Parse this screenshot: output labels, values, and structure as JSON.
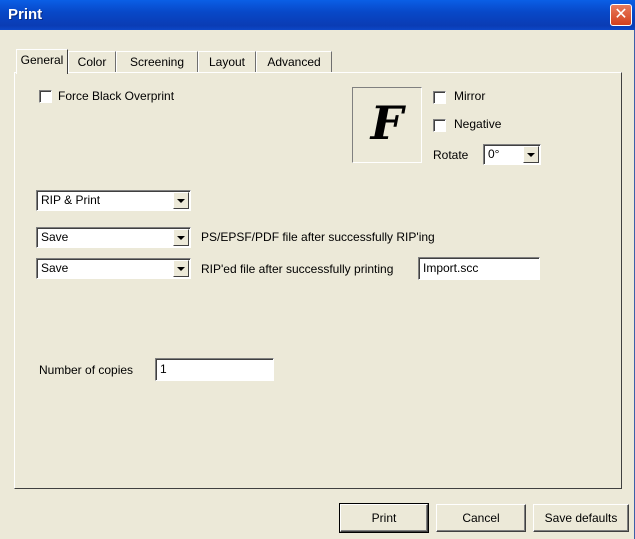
{
  "window": {
    "title": "Print",
    "close_symbol": "✕",
    "close_icon": "close-icon"
  },
  "tabs": [
    {
      "label": "General",
      "active": true
    },
    {
      "label": "Color",
      "active": false
    },
    {
      "label": "Screening",
      "active": false
    },
    {
      "label": "Layout",
      "active": false
    },
    {
      "label": "Advanced",
      "active": false
    }
  ],
  "general": {
    "force_black_overprint": {
      "label": "Force Black Overprint",
      "checked": false
    },
    "preview_glyph": "F",
    "mirror": {
      "label": "Mirror",
      "checked": false
    },
    "negative": {
      "label": "Negative",
      "checked": false
    },
    "rotate": {
      "label": "Rotate",
      "value": "0°"
    },
    "rip_mode": {
      "value": "RIP & Print"
    },
    "ps_file": {
      "value": "Save",
      "label": "PS/EPSF/PDF file after successfully RIP'ing"
    },
    "riped_file": {
      "value": "Save",
      "label": "RIP'ed file after successfully printing",
      "filename": "Import.scc"
    },
    "copies": {
      "label": "Number of copies",
      "value": "1"
    }
  },
  "buttons": {
    "print": "Print",
    "cancel": "Cancel",
    "save_defaults": "Save defaults"
  },
  "colors": {
    "titlebar": "#0a4fd8",
    "face": "#ece9d8",
    "close": "#d3401d"
  }
}
